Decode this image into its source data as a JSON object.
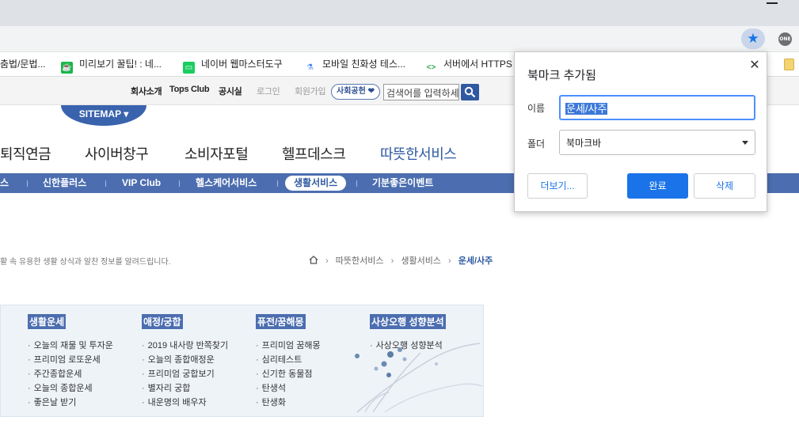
{
  "browser": {
    "bookmarks_bar": [
      {
        "label": "춤법/문법...",
        "icon": "bookmark-icon"
      },
      {
        "label": "미리보기 꿀팁! : 네...",
        "icon": "coffee-icon",
        "color": "#18b947"
      },
      {
        "label": "네이버 웹마스터도구",
        "icon": "monitor-icon",
        "color": "#19ce60"
      },
      {
        "label": "모바일 친화성 테스...",
        "icon": "lab-flask-icon",
        "color": "#4285f4"
      },
      {
        "label": "서버에서 HTTPS",
        "icon": "code-icon",
        "color": "#34a853"
      }
    ]
  },
  "site": {
    "util_links": [
      "회사소개",
      "Tops Club",
      "공시실",
      "로그인",
      "회원가입"
    ],
    "social_button": "사회공헌 ❤",
    "search_placeholder": "검색어를 입력하세요",
    "sitemap": "SITEMAP ▾",
    "gnb": [
      "퇴직연금",
      "사이버창구",
      "소비자포털",
      "헬프데스크",
      "따뜻한서비스"
    ],
    "subnav": [
      "스",
      "신한플러스",
      "VIP Club",
      "헬스케어서비스",
      "생활서비스",
      "기분좋은이벤트"
    ],
    "intro": "활 속 유용한 생활 상식과 알찬 정보를 알려드립니다.",
    "breadcrumb": [
      "따뜻한서비스",
      "생활서비스",
      "운세/사주"
    ],
    "columns": [
      {
        "title": "생활운세",
        "items": [
          "오늘의 재물 및 투자운",
          "프리미엄 로또운세",
          "주간종합운세",
          "오늘의 종합운세",
          "좋은날 받기"
        ]
      },
      {
        "title": "애정/궁합",
        "items": [
          "2019 내사랑 반쪽찾기",
          "오늘의 종합애정운",
          "프리미엄 궁합보기",
          "별자리 궁합",
          "내운명의 배우자"
        ]
      },
      {
        "title": "퓨전/꿈해몽",
        "items": [
          "프리미엄 꿈해몽",
          "심리테스트",
          "신기한 동물점",
          "탄생석",
          "탄생화"
        ]
      },
      {
        "title": "사상오행 성향분석",
        "items": [
          "사상오행 성향분석"
        ]
      }
    ]
  },
  "popup": {
    "title": "북마크 추가됨",
    "name_label": "이름",
    "name_value": "운세/사주",
    "folder_label": "폴더",
    "folder_value": "북마크바",
    "more_button": "더보기...",
    "done_button": "완료",
    "remove_button": "삭제"
  }
}
